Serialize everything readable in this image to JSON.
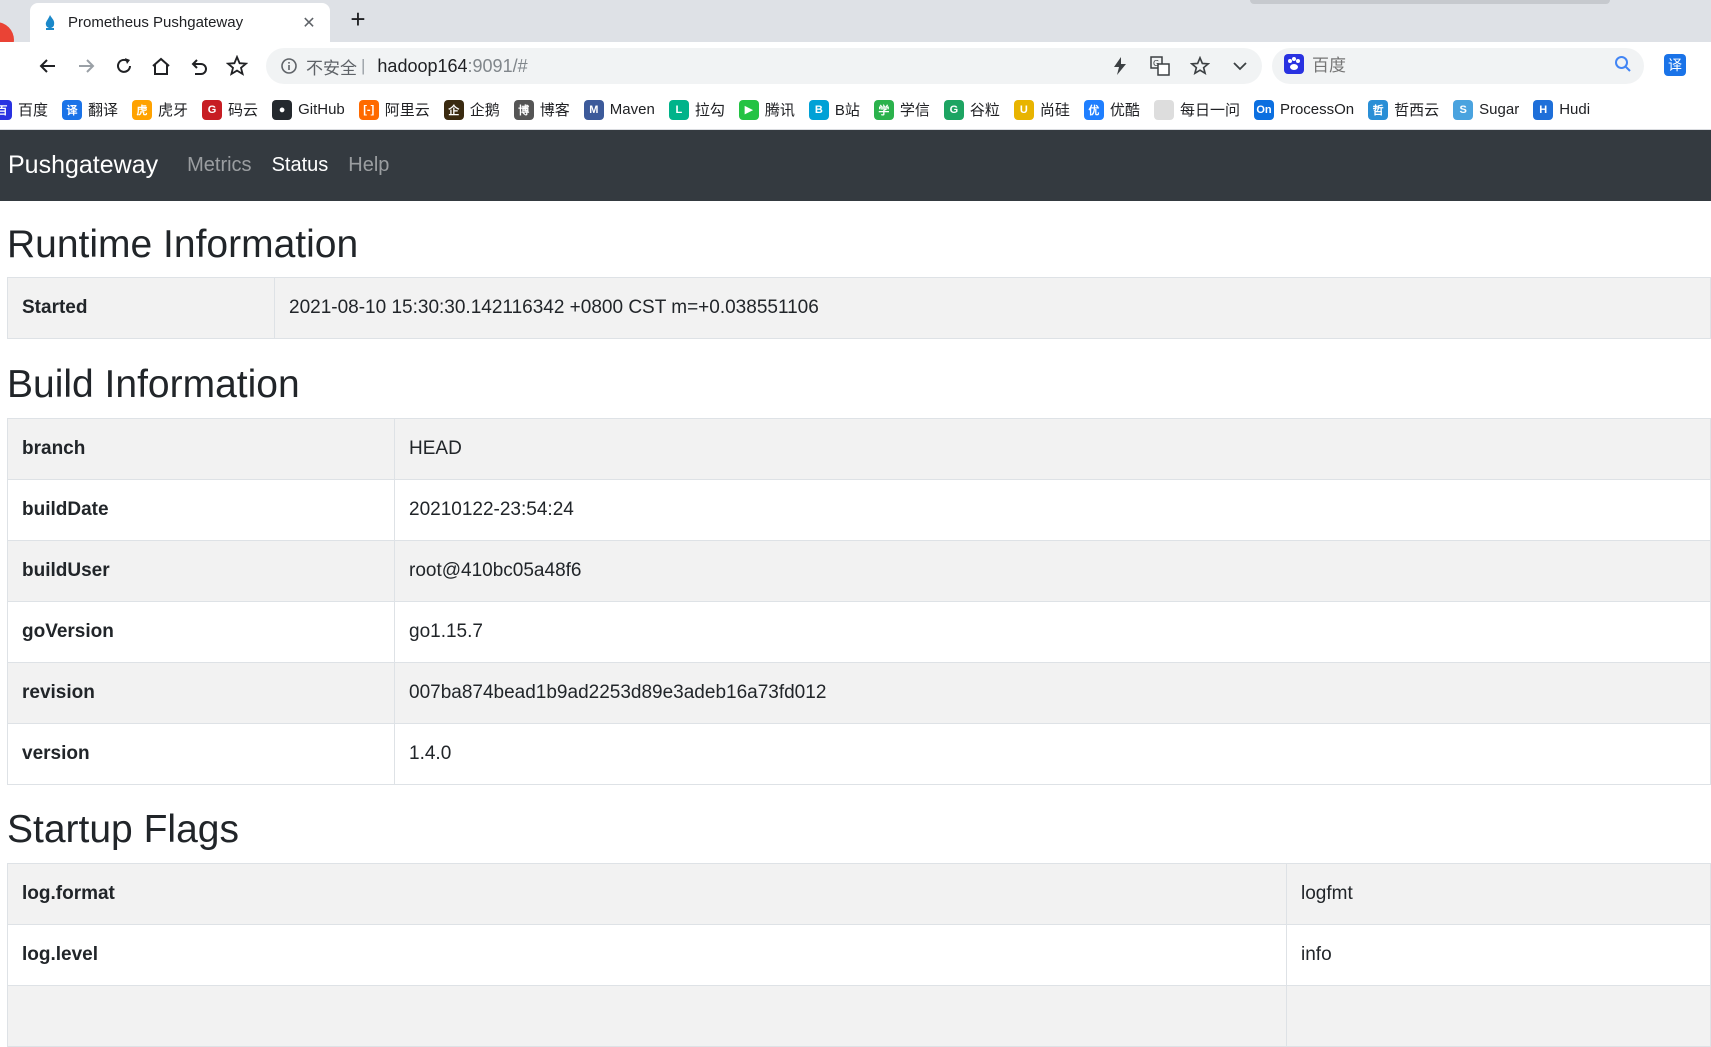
{
  "browser": {
    "tab_title": "Prometheus Pushgateway",
    "tab_close": "✕",
    "new_tab": "+",
    "omnibox": {
      "insecure_label": "不安全",
      "separator": "|",
      "host": "hadoop164",
      "path": ":9091/#"
    },
    "search_placeholder": "百度",
    "ext_label": "译",
    "bookmarks": [
      {
        "label": "百度",
        "color": "#2932e1",
        "glyph": "百"
      },
      {
        "label": "翻译",
        "color": "#1a73e8",
        "glyph": "译"
      },
      {
        "label": "虎牙",
        "color": "#ffa200",
        "glyph": "虎"
      },
      {
        "label": "码云",
        "color": "#c71d23",
        "glyph": "G"
      },
      {
        "label": "GitHub",
        "color": "#24292e",
        "glyph": "●"
      },
      {
        "label": "阿里云",
        "color": "#ff6a00",
        "glyph": "[-]"
      },
      {
        "label": "企鹅",
        "color": "#3a2a10",
        "glyph": "企"
      },
      {
        "label": "博客",
        "color": "#555555",
        "glyph": "博"
      },
      {
        "label": "Maven",
        "color": "#3c5a9a",
        "glyph": "M"
      },
      {
        "label": "拉勾",
        "color": "#00b38a",
        "glyph": "L"
      },
      {
        "label": "腾讯",
        "color": "#23c343",
        "glyph": "▶"
      },
      {
        "label": "B站",
        "color": "#00a1d6",
        "glyph": "B"
      },
      {
        "label": "学信",
        "color": "#2bb24c",
        "glyph": "学"
      },
      {
        "label": "谷粒",
        "color": "#1da462",
        "glyph": "G"
      },
      {
        "label": "尚硅",
        "color": "#e8b400",
        "glyph": "U"
      },
      {
        "label": "优酷",
        "color": "#1f7fff",
        "glyph": "优"
      },
      {
        "label": "每日一问",
        "color": "#dddddd",
        "glyph": ""
      },
      {
        "label": "ProcessOn",
        "color": "#0b6fe0",
        "glyph": "On"
      },
      {
        "label": "哲西云",
        "color": "#2a8fd6",
        "glyph": "哲"
      },
      {
        "label": "Sugar",
        "color": "#4aa3df",
        "glyph": "S"
      },
      {
        "label": "Hudi",
        "color": "#1e6fd9",
        "glyph": "H"
      }
    ]
  },
  "navbar": {
    "brand": "Pushgateway",
    "links": [
      {
        "label": "Metrics",
        "active": false
      },
      {
        "label": "Status",
        "active": true
      },
      {
        "label": "Help",
        "active": false
      }
    ]
  },
  "runtime": {
    "title": "Runtime Information",
    "rows": [
      {
        "key": "Started",
        "value": "2021-08-10 15:30:30.142116342 +0800 CST m=+0.038551106"
      }
    ]
  },
  "build": {
    "title": "Build Information",
    "rows": [
      {
        "key": "branch",
        "value": "HEAD"
      },
      {
        "key": "buildDate",
        "value": "20210122-23:54:24"
      },
      {
        "key": "buildUser",
        "value": "root@410bc05a48f6"
      },
      {
        "key": "goVersion",
        "value": "go1.15.7"
      },
      {
        "key": "revision",
        "value": "007ba874bead1b9ad2253d89e3adeb16a73fd012"
      },
      {
        "key": "version",
        "value": "1.4.0"
      }
    ]
  },
  "flags": {
    "title": "Startup Flags",
    "rows": [
      {
        "key": "log.format",
        "value": "logfmt"
      },
      {
        "key": "log.level",
        "value": "info"
      },
      {
        "key": "",
        "value": ""
      }
    ]
  }
}
